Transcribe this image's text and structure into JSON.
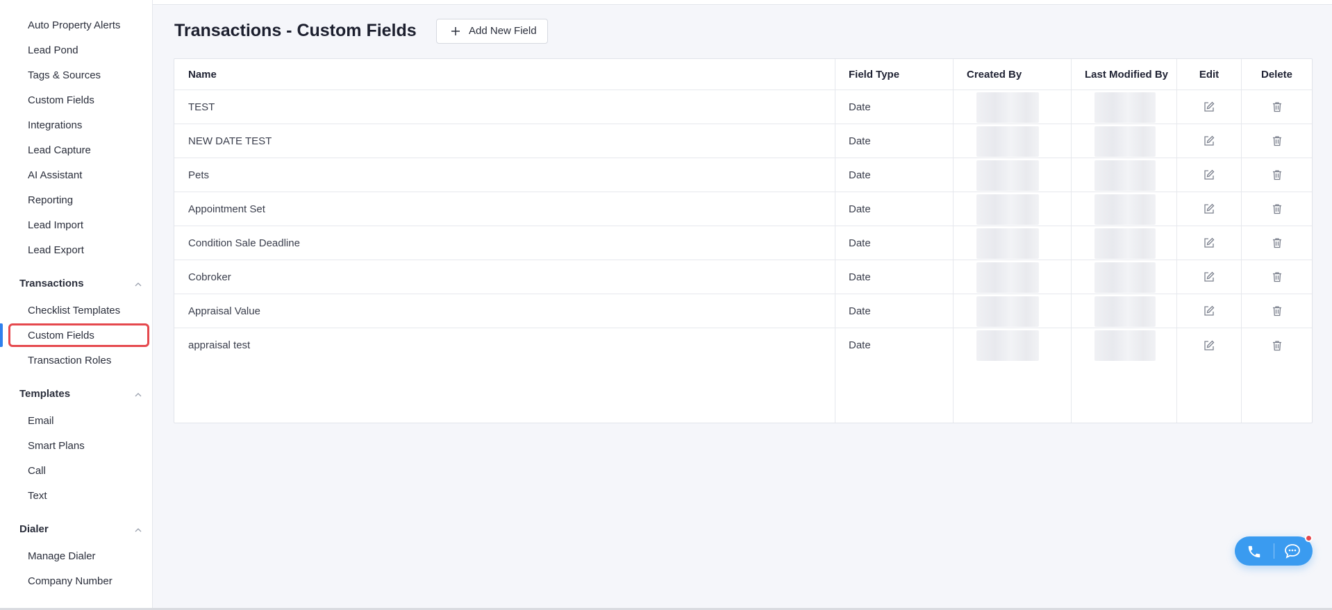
{
  "sidebar": {
    "top_items": [
      {
        "label": "Auto Property Alerts"
      },
      {
        "label": "Lead Pond"
      },
      {
        "label": "Tags & Sources"
      },
      {
        "label": "Custom Fields"
      },
      {
        "label": "Integrations"
      },
      {
        "label": "Lead Capture"
      },
      {
        "label": "AI Assistant"
      },
      {
        "label": "Reporting"
      },
      {
        "label": "Lead Import"
      },
      {
        "label": "Lead Export"
      }
    ],
    "groups": [
      {
        "title": "Transactions",
        "items": [
          {
            "label": "Checklist Templates"
          },
          {
            "label": "Custom Fields"
          },
          {
            "label": "Transaction Roles"
          }
        ]
      },
      {
        "title": "Templates",
        "items": [
          {
            "label": "Email"
          },
          {
            "label": "Smart Plans"
          },
          {
            "label": "Call"
          },
          {
            "label": "Text"
          }
        ]
      },
      {
        "title": "Dialer",
        "items": [
          {
            "label": "Manage Dialer"
          },
          {
            "label": "Company Number"
          }
        ]
      }
    ],
    "active_item": "Custom Fields"
  },
  "main": {
    "title": "Transactions - Custom Fields",
    "add_button_label": "Add New Field",
    "table": {
      "columns": [
        "Name",
        "Field Type",
        "Created By",
        "Last Modified By",
        "Edit",
        "Delete"
      ],
      "rows": [
        {
          "name": "TEST",
          "type": "Date"
        },
        {
          "name": "NEW DATE TEST",
          "type": "Date"
        },
        {
          "name": "Pets",
          "type": "Date"
        },
        {
          "name": "Appointment Set",
          "type": "Date"
        },
        {
          "name": "Condition Sale Deadline",
          "type": "Date"
        },
        {
          "name": "Cobroker",
          "type": "Date"
        },
        {
          "name": "Appraisal Value",
          "type": "Date"
        },
        {
          "name": "appraisal test",
          "type": "Date"
        }
      ]
    }
  },
  "colors": {
    "accent": "#2f80ed",
    "highlight": "#e5484d",
    "fab": "#3a9bf0"
  }
}
